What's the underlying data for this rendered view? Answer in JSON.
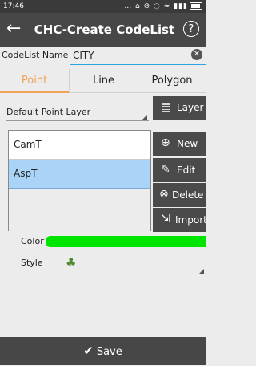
{
  "status_bar": {
    "time": "17:46",
    "icons": "… ⌂ ⊘ ◌ ≈ ▮▮▮"
  },
  "header": {
    "back_glyph": "←",
    "title": "CHC-Create CodeList",
    "help_glyph": "?"
  },
  "codelist_name": {
    "label": "CodeList Name",
    "value": "CITY",
    "clear_glyph": "✕"
  },
  "tabs": [
    {
      "label": "Point",
      "active": true
    },
    {
      "label": "Line",
      "active": false
    },
    {
      "label": "Polygon",
      "active": false
    }
  ],
  "layer_select": {
    "value": "Default Point Layer"
  },
  "code_list": [
    {
      "label": "CamT",
      "selected": false
    },
    {
      "label": "AspT",
      "selected": true
    }
  ],
  "side_buttons": {
    "layer": {
      "label": "Layer",
      "icon": "layers-icon"
    },
    "new": {
      "label": "New",
      "icon": "add-icon"
    },
    "edit": {
      "label": "Edit",
      "icon": "pencil-icon"
    },
    "delete": {
      "label": "Delete",
      "icon": "delete-circle-icon"
    },
    "import": {
      "label": "Import",
      "icon": "import-icon"
    }
  },
  "color": {
    "label": "Color",
    "value": "#00e500"
  },
  "style": {
    "label": "Style",
    "icon": "tree-icon"
  },
  "footer": {
    "save_label": "Save"
  },
  "theme": {
    "accent": "#f0a35a",
    "selection": "#a9d3f7",
    "bar": "#474747"
  }
}
